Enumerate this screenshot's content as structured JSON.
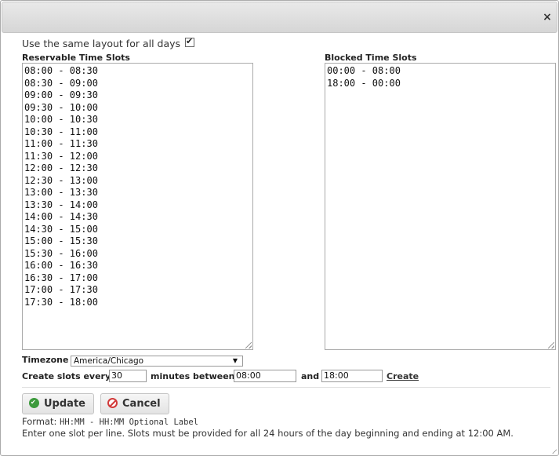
{
  "dialog": {
    "close_glyph": "×"
  },
  "layout_option": {
    "label": "Use the same layout for all days",
    "checked": true
  },
  "reservable": {
    "label": "Reservable Time Slots",
    "slots": [
      "08:00 - 08:30",
      "08:30 - 09:00",
      "09:00 - 09:30",
      "09:30 - 10:00",
      "10:00 - 10:30",
      "10:30 - 11:00",
      "11:00 - 11:30",
      "11:30 - 12:00",
      "12:00 - 12:30",
      "12:30 - 13:00",
      "13:00 - 13:30",
      "13:30 - 14:00",
      "14:00 - 14:30",
      "14:30 - 15:00",
      "15:00 - 15:30",
      "15:30 - 16:00",
      "16:00 - 16:30",
      "16:30 - 17:00",
      "17:00 - 17:30",
      "17:30 - 18:00"
    ]
  },
  "blocked": {
    "label": "Blocked Time Slots",
    "slots": [
      "00:00 - 08:00",
      "18:00 - 00:00"
    ]
  },
  "timezone": {
    "label": "Timezone",
    "value": "America/Chicago"
  },
  "create": {
    "label_every": "Create slots every",
    "interval_value": "30",
    "label_between": "minutes between",
    "start_value": "08:00",
    "label_and": "and",
    "end_value": "18:00",
    "link_label": "Create"
  },
  "buttons": {
    "update_label": "Update",
    "cancel_label": "Cancel"
  },
  "help": {
    "format_prefix": "Format:",
    "format_example": "HH:MM - HH:MM Optional Label",
    "instructions": "Enter one slot per line. Slots must be provided for all 24 hours of the day beginning and ending at 12:00 AM."
  },
  "colors": {
    "titlebar": "#dcdcdc",
    "update_icon": "#3c9a3c",
    "cancel_icon": "#d23a3a"
  }
}
